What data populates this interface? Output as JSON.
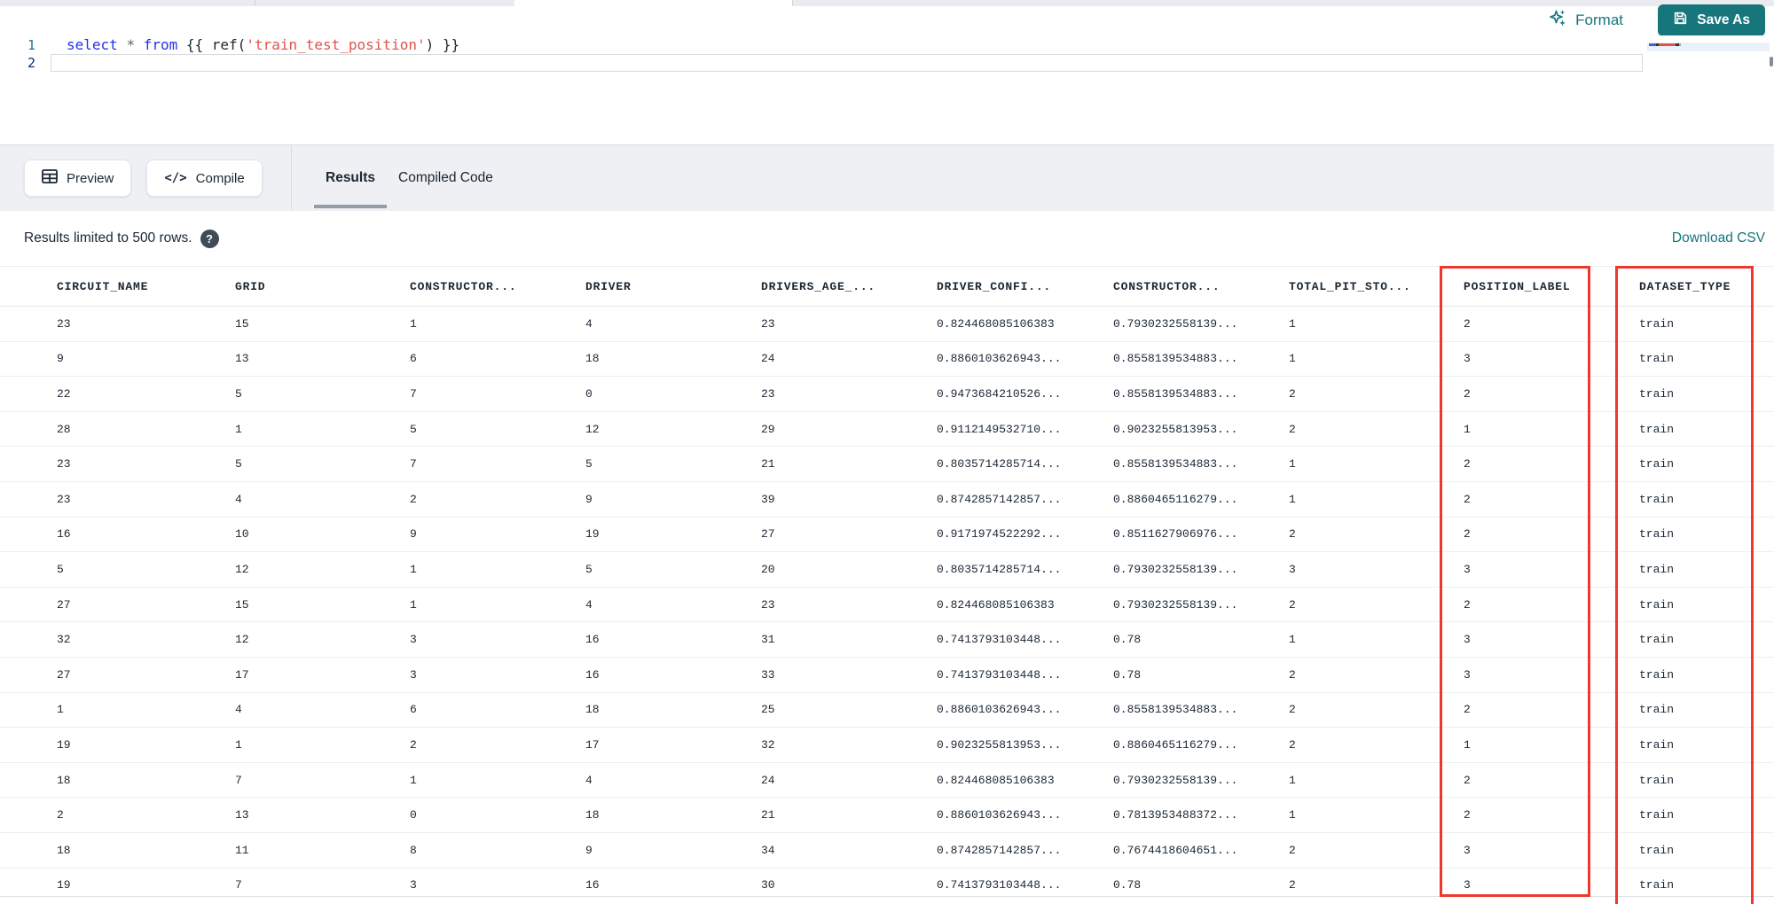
{
  "toolbar": {
    "format_label": "Format",
    "save_as_label": "Save As"
  },
  "editor": {
    "line_numbers": [
      "1",
      "2"
    ],
    "code_segments": [
      {
        "text": "select",
        "token": "keyword"
      },
      {
        "text": " ",
        "token": "plain"
      },
      {
        "text": "*",
        "token": "operator"
      },
      {
        "text": " ",
        "token": "plain"
      },
      {
        "text": "from",
        "token": "keyword"
      },
      {
        "text": " {{ ",
        "token": "plain"
      },
      {
        "text": "ref(",
        "token": "plain"
      },
      {
        "text": "'train_test_position'",
        "token": "string"
      },
      {
        "text": ") }}",
        "token": "plain"
      }
    ]
  },
  "panel": {
    "preview_label": "Preview",
    "compile_label": "Compile",
    "compile_glyph": "</>",
    "tabs": [
      {
        "label": "Results",
        "active": true
      },
      {
        "label": "Compiled Code",
        "active": false
      }
    ]
  },
  "results": {
    "info_text": "Results limited to 500 rows.",
    "help_glyph": "?",
    "download_label": "Download CSV"
  },
  "table": {
    "headers": [
      "CIRCUIT_NAME",
      "GRID",
      "CONSTRUCTOR...",
      "DRIVER",
      "DRIVERS_AGE_...",
      "DRIVER_CONFI...",
      "CONSTRUCTOR...",
      "TOTAL_PIT_STO...",
      "POSITION_LABEL",
      "DATASET_TYPE"
    ],
    "rows": [
      [
        "23",
        "15",
        "1",
        "4",
        "23",
        "0.824468085106383",
        "0.7930232558139...",
        "1",
        "2",
        "train"
      ],
      [
        "9",
        "13",
        "6",
        "18",
        "24",
        "0.8860103626943...",
        "0.8558139534883...",
        "1",
        "3",
        "train"
      ],
      [
        "22",
        "5",
        "7",
        "0",
        "23",
        "0.9473684210526...",
        "0.8558139534883...",
        "2",
        "2",
        "train"
      ],
      [
        "28",
        "1",
        "5",
        "12",
        "29",
        "0.9112149532710...",
        "0.9023255813953...",
        "2",
        "1",
        "train"
      ],
      [
        "23",
        "5",
        "7",
        "5",
        "21",
        "0.8035714285714...",
        "0.8558139534883...",
        "1",
        "2",
        "train"
      ],
      [
        "23",
        "4",
        "2",
        "9",
        "39",
        "0.8742857142857...",
        "0.8860465116279...",
        "1",
        "2",
        "train"
      ],
      [
        "16",
        "10",
        "9",
        "19",
        "27",
        "0.9171974522292...",
        "0.8511627906976...",
        "2",
        "2",
        "train"
      ],
      [
        "5",
        "12",
        "1",
        "5",
        "20",
        "0.8035714285714...",
        "0.7930232558139...",
        "3",
        "3",
        "train"
      ],
      [
        "27",
        "15",
        "1",
        "4",
        "23",
        "0.824468085106383",
        "0.7930232558139...",
        "2",
        "2",
        "train"
      ],
      [
        "32",
        "12",
        "3",
        "16",
        "31",
        "0.7413793103448...",
        "0.78",
        "1",
        "3",
        "train"
      ],
      [
        "27",
        "17",
        "3",
        "16",
        "33",
        "0.7413793103448...",
        "0.78",
        "2",
        "3",
        "train"
      ],
      [
        "1",
        "4",
        "6",
        "18",
        "25",
        "0.8860103626943...",
        "0.8558139534883...",
        "2",
        "2",
        "train"
      ],
      [
        "19",
        "1",
        "2",
        "17",
        "32",
        "0.9023255813953...",
        "0.8860465116279...",
        "2",
        "1",
        "train"
      ],
      [
        "18",
        "7",
        "1",
        "4",
        "24",
        "0.824468085106383",
        "0.7930232558139...",
        "1",
        "2",
        "train"
      ],
      [
        "2",
        "13",
        "0",
        "18",
        "21",
        "0.8860103626943...",
        "0.7813953488372...",
        "1",
        "2",
        "train"
      ],
      [
        "18",
        "11",
        "8",
        "9",
        "34",
        "0.8742857142857...",
        "0.7674418604651...",
        "2",
        "3",
        "train"
      ],
      [
        "19",
        "7",
        "3",
        "16",
        "30",
        "0.7413793103448...",
        "0.78",
        "2",
        "3",
        "train"
      ]
    ]
  },
  "highlights": {
    "boxed_columns": [
      "POSITION_LABEL",
      "DATASET_TYPE"
    ],
    "box_color": "#ef372c"
  },
  "colors": {
    "accent_teal": "#16767c",
    "highlight_red": "#ef372c",
    "keyword_blue": "#2231f0",
    "string_red": "#e0534a",
    "header_gray": "#5c6975",
    "text_dark": "#1b2733"
  },
  "icons": {
    "format": "sparkles-icon",
    "save_as": "floppy-disk-icon",
    "preview": "table-grid-icon",
    "compile": "code-brackets-icon",
    "help": "question-circle-icon"
  }
}
